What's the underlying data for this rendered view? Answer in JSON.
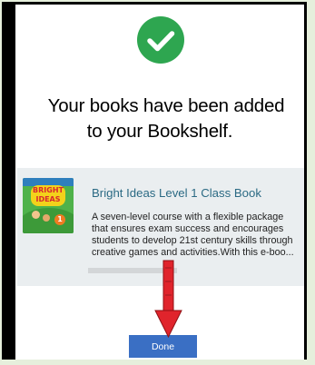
{
  "headline": {
    "line1": "Your books have been added",
    "line2": "to your Bookshelf."
  },
  "book": {
    "title": "Bright Ideas Level 1 Class Book",
    "description_lines": [
      "A seven-level course with a flexible package",
      "that ensures exam success and encourages",
      "students to develop 21st century skills through",
      "creative games and activities.With this e-boo..."
    ],
    "cover_text": "BRIGHT IDEAS",
    "cover_level": "1"
  },
  "done_label": "Done",
  "colors": {
    "success": "#2ea650",
    "button": "#3a6fc4",
    "title_link": "#2b6a84",
    "annotation_arrow": "#e0242c"
  },
  "icons": {
    "success": "check-circle-icon",
    "annotation": "arrow-down-icon"
  }
}
